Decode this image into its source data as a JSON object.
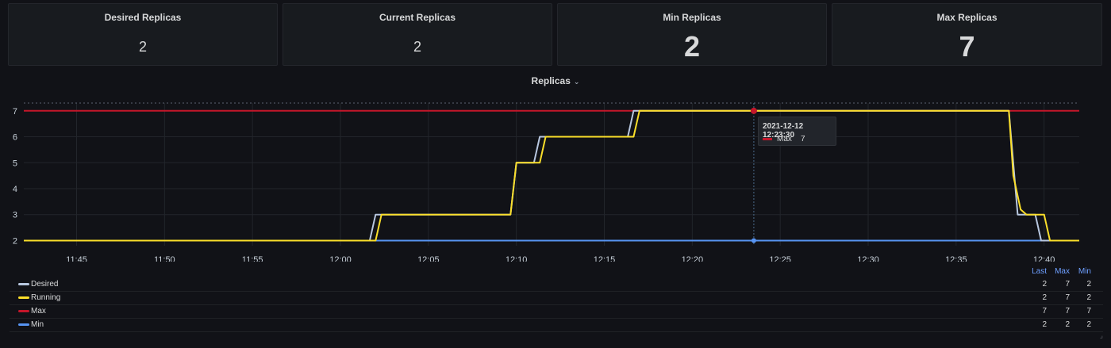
{
  "stats": [
    {
      "title": "Desired Replicas",
      "value": "2"
    },
    {
      "title": "Current Replicas",
      "value": "2"
    },
    {
      "title": "Min Replicas",
      "value": "2"
    },
    {
      "title": "Max Replicas",
      "value": "7"
    }
  ],
  "panel": {
    "title": "Replicas",
    "chevron": "⌄"
  },
  "tooltip": {
    "time": "2021-12-12 12:23:30",
    "series": "Max",
    "value": "7"
  },
  "legend": {
    "headers": [
      "Last",
      "Max",
      "Min"
    ],
    "items": [
      {
        "name": "Desired",
        "color": "#b8c7e0",
        "last": "2",
        "max": "7",
        "min": "2"
      },
      {
        "name": "Running",
        "color": "#fade2a",
        "last": "2",
        "max": "7",
        "min": "2"
      },
      {
        "name": "Max",
        "color": "#c4162a",
        "last": "7",
        "max": "7",
        "min": "7"
      },
      {
        "name": "Min",
        "color": "#5794f2",
        "last": "2",
        "max": "2",
        "min": "2"
      }
    ]
  },
  "chart_data": {
    "type": "line",
    "xlabel": "",
    "ylabel": "",
    "x_ticks": [
      "11:45",
      "11:50",
      "11:55",
      "12:00",
      "12:05",
      "12:10",
      "12:15",
      "12:20",
      "12:25",
      "12:30",
      "12:35",
      "12:40"
    ],
    "y_ticks": [
      2,
      3,
      4,
      5,
      6,
      7
    ],
    "xlim": [
      "11:42",
      "12:42"
    ],
    "ylim": [
      1.8,
      7.3
    ],
    "threshold_y": 7.3,
    "crosshair_x": "12:23:30",
    "series": [
      {
        "name": "Desired",
        "color": "#b8c7e0",
        "points": [
          [
            "11:42",
            2
          ],
          [
            "12:01:40",
            2
          ],
          [
            "12:02",
            3
          ],
          [
            "12:09:40",
            3
          ],
          [
            "12:10",
            5
          ],
          [
            "12:11",
            5
          ],
          [
            "12:11:20",
            6
          ],
          [
            "12:16:20",
            6
          ],
          [
            "12:16:40",
            7
          ],
          [
            "12:38",
            7
          ],
          [
            "12:38:30",
            3
          ],
          [
            "12:39:30",
            3
          ],
          [
            "12:39:50",
            2
          ],
          [
            "12:42",
            2
          ]
        ]
      },
      {
        "name": "Running",
        "color": "#fade2a",
        "points": [
          [
            "11:42",
            2
          ],
          [
            "12:02",
            2
          ],
          [
            "12:02:20",
            3
          ],
          [
            "12:09:40",
            3
          ],
          [
            "12:10",
            5
          ],
          [
            "12:11:20",
            5
          ],
          [
            "12:11:40",
            6
          ],
          [
            "12:16:40",
            6
          ],
          [
            "12:17",
            7
          ],
          [
            "12:38",
            7
          ],
          [
            "12:38:15",
            4.5
          ],
          [
            "12:38:40",
            3.2
          ],
          [
            "12:39:00",
            3
          ],
          [
            "12:40:00",
            3
          ],
          [
            "12:40:20",
            2
          ],
          [
            "12:42",
            2
          ]
        ]
      },
      {
        "name": "Max",
        "color": "#c4162a",
        "points": [
          [
            "11:42",
            7
          ],
          [
            "12:42",
            7
          ]
        ]
      },
      {
        "name": "Min",
        "color": "#5794f2",
        "points": [
          [
            "11:42",
            2
          ],
          [
            "12:42",
            2
          ]
        ]
      }
    ]
  }
}
